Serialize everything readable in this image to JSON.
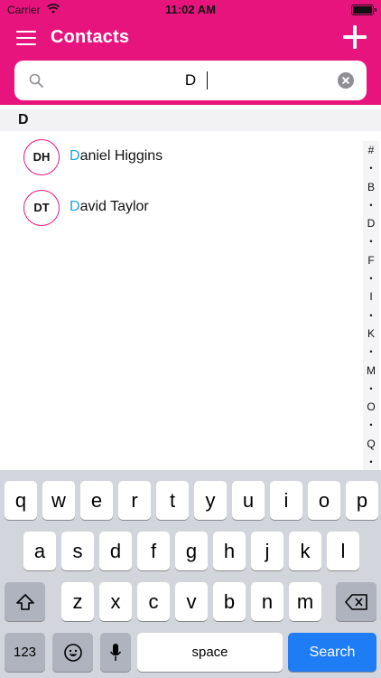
{
  "status_bar": {
    "carrier": "Carrier",
    "time": "11:02 AM"
  },
  "nav": {
    "title": "Contacts"
  },
  "search": {
    "value": "D"
  },
  "section": {
    "letter": "D"
  },
  "contacts": [
    {
      "initials": "DH",
      "match": "D",
      "rest": "aniel Higgins"
    },
    {
      "initials": "DT",
      "match": "D",
      "rest": "avid Taylor"
    }
  ],
  "index_rail": [
    "#",
    "•",
    "B",
    "•",
    "D",
    "•",
    "F",
    "•",
    "I",
    "•",
    "K",
    "•",
    "M",
    "•",
    "O",
    "•",
    "Q",
    "•"
  ],
  "keyboard": {
    "row1": [
      "q",
      "w",
      "e",
      "r",
      "t",
      "y",
      "u",
      "i",
      "o",
      "p"
    ],
    "row2": [
      "a",
      "s",
      "d",
      "f",
      "g",
      "h",
      "j",
      "k",
      "l"
    ],
    "row3": [
      "z",
      "x",
      "c",
      "v",
      "b",
      "n",
      "m"
    ],
    "numbers_label": "123",
    "space_label": "space",
    "search_label": "Search"
  },
  "colors": {
    "accent": "#e8147e",
    "highlight": "#1aa3e8",
    "search_key": "#1e7cf5"
  }
}
